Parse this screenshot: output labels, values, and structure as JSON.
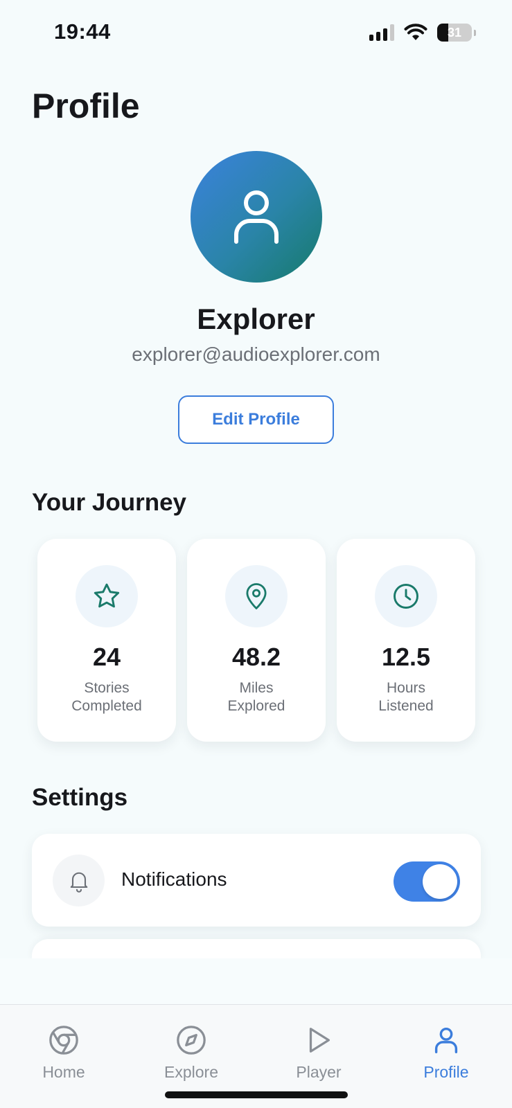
{
  "status_bar": {
    "time": "19:44",
    "battery_level": "31",
    "battery_fraction": 0.31,
    "icons": [
      "cellular-signal-icon",
      "wifi-icon",
      "battery-icon"
    ]
  },
  "header": {
    "title": "Profile"
  },
  "profile": {
    "avatar_icon": "user-icon",
    "name": "Explorer",
    "email": "explorer@audioexplorer.com",
    "edit_label": "Edit Profile"
  },
  "journey": {
    "title": "Your Journey",
    "stats": [
      {
        "icon": "star-icon",
        "value": "24",
        "label_line1": "Stories",
        "label_line2": "Completed"
      },
      {
        "icon": "map-pin-icon",
        "value": "48.2",
        "label_line1": "Miles",
        "label_line2": "Explored"
      },
      {
        "icon": "clock-icon",
        "value": "12.5",
        "label_line1": "Hours",
        "label_line2": "Listened"
      }
    ]
  },
  "settings": {
    "title": "Settings",
    "items": [
      {
        "icon": "bell-icon",
        "label": "Notifications",
        "enabled": true
      }
    ]
  },
  "tab_bar": {
    "items": [
      {
        "icon": "chrome-icon",
        "label": "Home",
        "active": false
      },
      {
        "icon": "compass-icon",
        "label": "Explore",
        "active": false
      },
      {
        "icon": "play-icon",
        "label": "Player",
        "active": false
      },
      {
        "icon": "user-icon",
        "label": "Profile",
        "active": true
      }
    ]
  },
  "colors": {
    "accent": "#3b7ddc",
    "teal": "#1a7a6a",
    "background": "#f5fbfc",
    "inactive": "#8a8f96"
  }
}
